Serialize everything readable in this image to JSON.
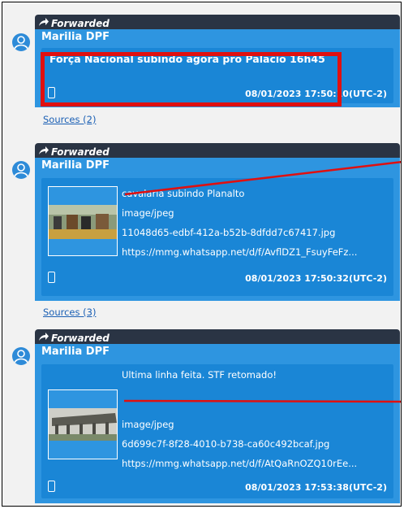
{
  "forward_label": "Forwarded",
  "messages": [
    {
      "sender": "Marilia DPF",
      "text": "Força Nacional subindo agora pro Palácio 16h45",
      "timestamp": "08/01/2023 17:50:10(UTC-2)",
      "sources": "Sources (2)"
    },
    {
      "sender": "Marilia DPF",
      "caption": "cavalaria subindo Planalto",
      "mime": "image/jpeg",
      "filename": "11048d65-edbf-412a-b52b-8dfdd7c67417.jpg",
      "url": "https://mmg.whatsapp.net/d/f/AvflDZ1_FsuyFeFz...",
      "timestamp": "08/01/2023 17:50:32(UTC-2)",
      "sources": "Sources (3)"
    },
    {
      "sender": "Marilia DPF",
      "caption": "Ultima linha feita. STF retomado!",
      "mime": "image/jpeg",
      "filename": "6d699c7f-8f28-4010-b738-ca60c492bcaf.jpg",
      "url": "https://mmg.whatsapp.net/d/f/AtQaRnOZQ10rEe...",
      "timestamp": "08/01/2023 17:53:38(UTC-2)"
    }
  ],
  "colors": {
    "header": "#2a3444",
    "bubble": "#2e95e0",
    "inner": "#1a86d6",
    "highlight": "#e01010",
    "link": "#1a5fb4"
  }
}
